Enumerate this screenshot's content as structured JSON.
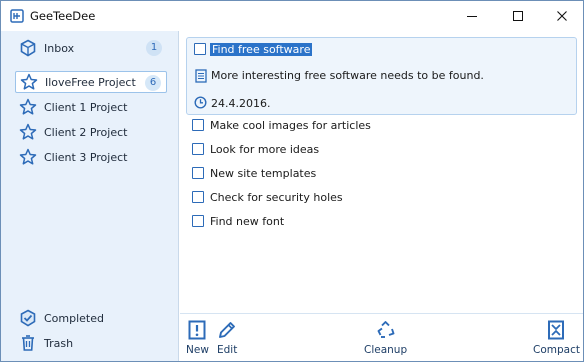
{
  "window": {
    "title": "GeeTeeDee",
    "accent": "#2d6bb8"
  },
  "sidebar": {
    "items": [
      {
        "label": "Inbox",
        "count": "1",
        "icon": "inbox-icon"
      },
      {
        "label": "IloveFree Project",
        "count": "6",
        "icon": "star-icon",
        "selected": true
      },
      {
        "label": "Client 1 Project",
        "icon": "star-icon"
      },
      {
        "label": "Client 2 Project",
        "icon": "star-icon"
      },
      {
        "label": "Client 3 Project",
        "icon": "star-icon"
      }
    ],
    "bottom_items": [
      {
        "label": "Completed",
        "icon": "completed-icon"
      },
      {
        "label": "Trash",
        "icon": "trash-icon"
      }
    ]
  },
  "selected_task": {
    "title": "Find free software",
    "note": "More interesting free software needs to be found.",
    "date": "24.4.2016."
  },
  "tasks": [
    {
      "title": "Make cool images for articles"
    },
    {
      "title": "Look for more ideas"
    },
    {
      "title": "New site templates"
    },
    {
      "title": "Check for security holes"
    },
    {
      "title": "Find new font"
    }
  ],
  "toolbar": {
    "new_label": "New",
    "edit_label": "Edit",
    "cleanup_label": "Cleanup",
    "compact_label": "Compact"
  }
}
